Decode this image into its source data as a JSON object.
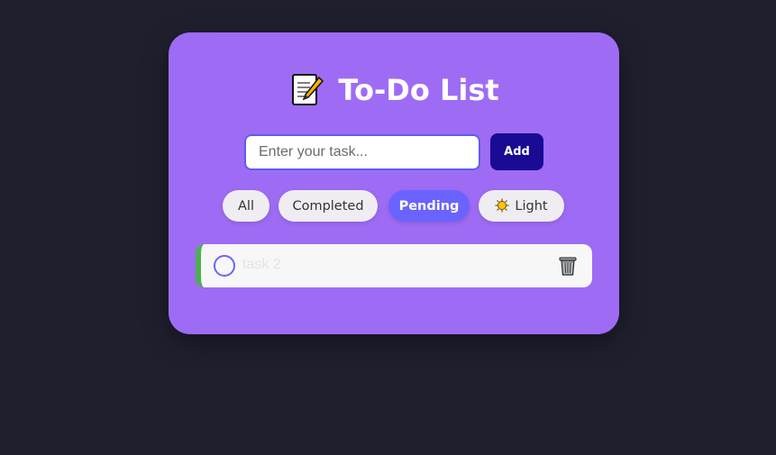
{
  "header": {
    "icon": "memo-icon",
    "title": "To-Do List"
  },
  "form": {
    "placeholder": "Enter your task...",
    "value": "",
    "add_label": "Add"
  },
  "filters": [
    {
      "label": "All",
      "active": false
    },
    {
      "label": "Completed",
      "active": false
    },
    {
      "label": "Pending",
      "active": true
    },
    {
      "label": "Light",
      "icon": "sun-icon",
      "active": false
    }
  ],
  "tasks": [
    {
      "text": "task 2",
      "completed": false,
      "icon_check": "circle-icon",
      "icon_delete": "trash-icon"
    }
  ],
  "colors": {
    "background": "#1f1f2e",
    "card": "#9e6cf4",
    "accent": "#6a63ff",
    "add_button": "#1a0b94",
    "task_border": "#4caf50"
  }
}
